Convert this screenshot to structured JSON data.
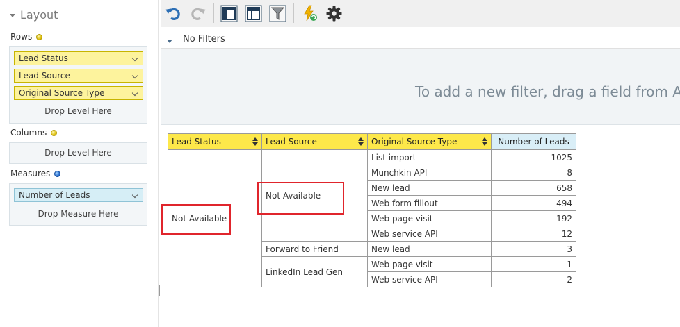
{
  "layout": {
    "title": "Layout",
    "rows": {
      "label": "Rows",
      "fields": [
        "Lead Status",
        "Lead Source",
        "Original Source Type"
      ],
      "drop_hint": "Drop Level Here"
    },
    "columns": {
      "label": "Columns",
      "drop_hint": "Drop Level Here"
    },
    "measures": {
      "label": "Measures",
      "fields": [
        "Number of Leads"
      ],
      "drop_hint": "Drop Measure Here"
    }
  },
  "toolbar": {
    "icons": [
      "undo-icon",
      "redo-icon",
      "layout-compact-icon",
      "layout-tabular-icon",
      "filter-icon",
      "refresh-icon",
      "gear-icon"
    ]
  },
  "filters": {
    "label": "No Filters",
    "hint": "To add a new filter, drag a field from Avai"
  },
  "pivot": {
    "headers": [
      "Lead Status",
      "Lead Source",
      "Original Source Type",
      "Number of Leads"
    ],
    "lead_status": "Not Available",
    "groups": [
      {
        "source": "Not Available",
        "rows": [
          {
            "type": "List import",
            "count": "1025"
          },
          {
            "type": "Munchkin API",
            "count": "8"
          },
          {
            "type": "New lead",
            "count": "658"
          },
          {
            "type": "Web form fillout",
            "count": "494"
          },
          {
            "type": "Web page visit",
            "count": "192"
          },
          {
            "type": "Web service API",
            "count": "12"
          }
        ]
      },
      {
        "source": "Forward to Friend",
        "rows": [
          {
            "type": "New lead",
            "count": "3"
          }
        ]
      },
      {
        "source": "LinkedIn Lead Gen",
        "rows": [
          {
            "type": "Web page visit",
            "count": "1"
          },
          {
            "type": "Web service API",
            "count": "2"
          }
        ]
      }
    ]
  },
  "colors": {
    "header_yellow": "#fde84a",
    "measure_blue": "#d9eef7",
    "pill_yellow": "#fdf39d",
    "pill_blue": "#d6eef6",
    "highlight_red": "#e0252c"
  }
}
